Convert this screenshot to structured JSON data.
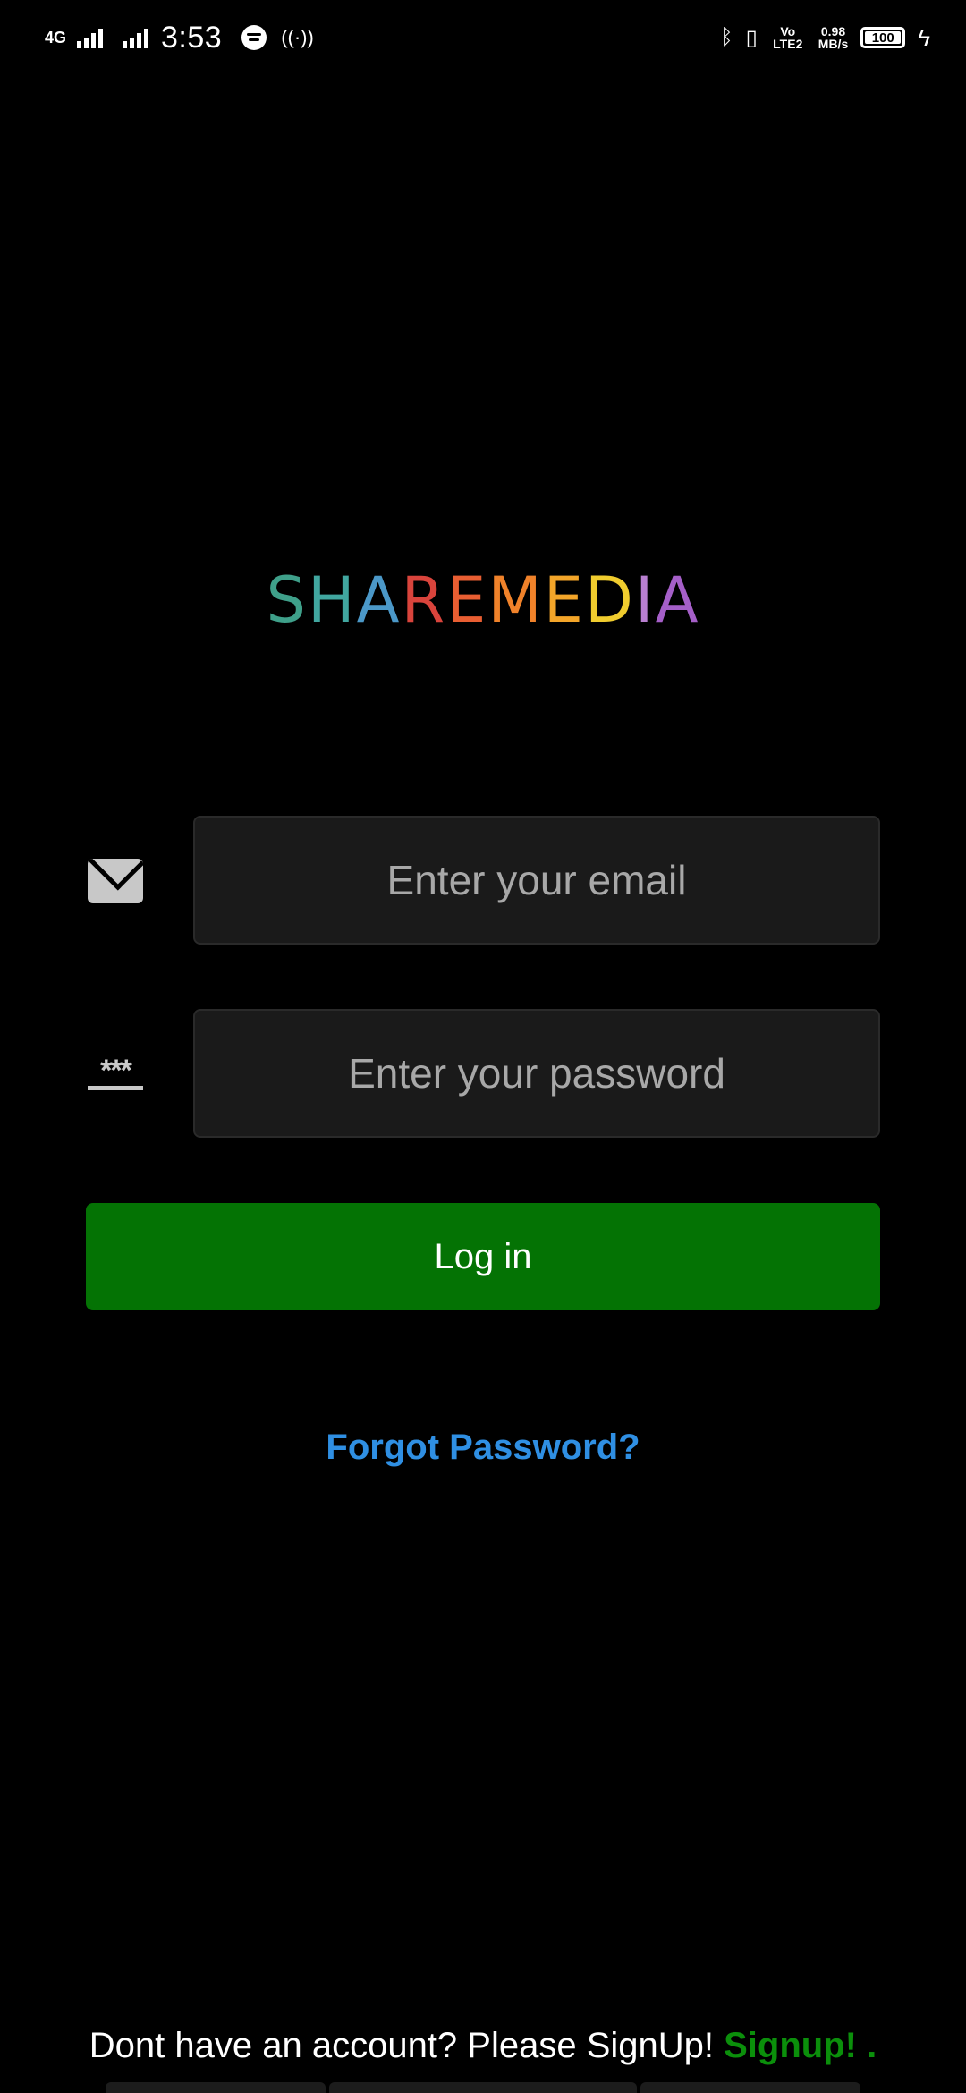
{
  "status_bar": {
    "network": "4G",
    "time": "3:53",
    "volte": "Vo LTE2",
    "speed_value": "0.98",
    "speed_unit": "MB/s",
    "battery": "100",
    "icons": [
      "signal-icon",
      "spotify-icon",
      "hotspot-icon",
      "bluetooth-icon",
      "vibrate-icon",
      "charging-icon"
    ]
  },
  "logo": {
    "letters": [
      {
        "char": "S",
        "color": "#3fa08a"
      },
      {
        "char": "H",
        "color": "#41a7a0"
      },
      {
        "char": "A",
        "color": "#4b98c8"
      },
      {
        "char": "R",
        "color": "#d9443c"
      },
      {
        "char": "E",
        "color": "#e95e32"
      },
      {
        "char": "M",
        "color": "#f0822a"
      },
      {
        "char": "E",
        "color": "#f3a529"
      },
      {
        "char": "D",
        "color": "#f0cc2e"
      },
      {
        "char": "I",
        "color": "#b87fd0"
      },
      {
        "char": "A",
        "color": "#a55fc8"
      }
    ]
  },
  "form": {
    "email_placeholder": "Enter your email",
    "password_placeholder": "Enter your password",
    "password_icon_text": "***",
    "login_label": "Log in",
    "forgot_label": "Forgot Password?"
  },
  "footer": {
    "prompt": "Dont have an account? Please SignUp! ",
    "signup_label": "Signup!",
    "trailing": " ."
  },
  "colors": {
    "background": "#000000",
    "login_button": "#047304",
    "forgot_link": "#2f8fe3",
    "signup_link": "#0b8f0b",
    "field_bg": "#1a1a1a"
  }
}
